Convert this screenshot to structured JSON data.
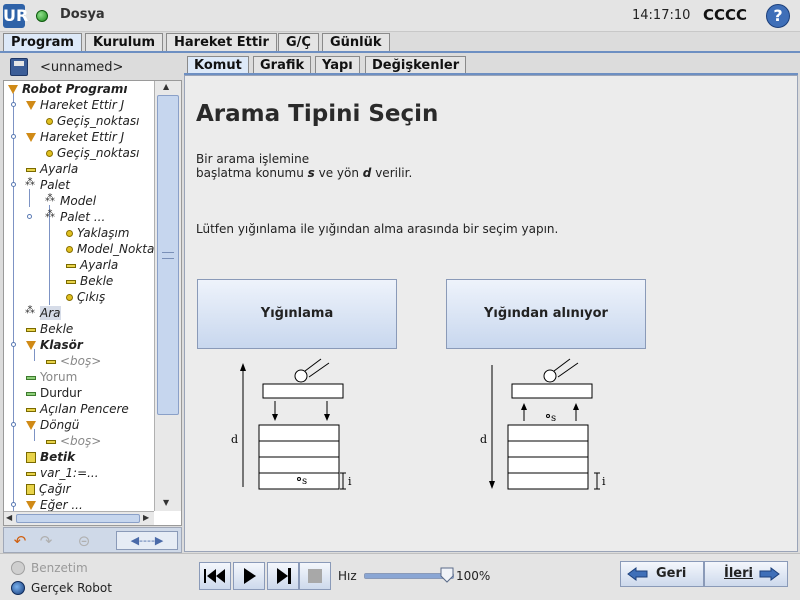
{
  "titlebar": {
    "file_name": "Dosya",
    "clock": "14:17:10",
    "robot_name": "CCCC",
    "logo_text": "UR",
    "help_text": "?"
  },
  "main_tabs": [
    "Program",
    "Kurulum",
    "Hareket Ettir",
    "G/Ç",
    "Günlük"
  ],
  "program": {
    "name": "<unnamed>"
  },
  "tree": {
    "items": [
      {
        "label": "Robot Programı",
        "icon": "program-icon"
      },
      {
        "label": "Hareket Ettir J",
        "icon": "move-icon"
      },
      {
        "label": "Geçiş_noktası",
        "icon": "waypoint-icon"
      },
      {
        "label": "Hareket Ettir J",
        "icon": "move-icon"
      },
      {
        "label": "Geçiş_noktası",
        "icon": "waypoint-icon"
      },
      {
        "label": "Ayarla",
        "icon": "set-icon"
      },
      {
        "label": "Palet",
        "icon": "pallet-icon"
      },
      {
        "label": "Model",
        "icon": "pattern-icon"
      },
      {
        "label": "Palet ...",
        "icon": "pallet-sequence-icon"
      },
      {
        "label": "Yaklaşım",
        "icon": "waypoint-icon"
      },
      {
        "label": "Model_Nokta",
        "icon": "waypoint-icon"
      },
      {
        "label": "Ayarla",
        "icon": "set-icon"
      },
      {
        "label": "Bekle",
        "icon": "wait-icon"
      },
      {
        "label": "Çıkış",
        "icon": "waypoint-icon"
      },
      {
        "label": "Ara",
        "icon": "seek-icon"
      },
      {
        "label": "Bekle",
        "icon": "wait-icon"
      },
      {
        "label": "Klasör",
        "icon": "folder-icon"
      },
      {
        "label": "<boş>",
        "icon": "empty-icon"
      },
      {
        "label": "Yorum",
        "icon": "comment-icon"
      },
      {
        "label": "Durdur",
        "icon": "halt-icon"
      },
      {
        "label": "Açılan Pencere",
        "icon": "popup-icon"
      },
      {
        "label": "Döngü",
        "icon": "loop-icon"
      },
      {
        "label": "<boş>",
        "icon": "empty-icon"
      },
      {
        "label": "Betik",
        "icon": "script-icon"
      },
      {
        "label": "var_1:=...",
        "icon": "assignment-icon"
      },
      {
        "label": "Çağır",
        "icon": "call-icon"
      },
      {
        "label": "Eğer ...",
        "icon": "if-icon"
      }
    ]
  },
  "sub_tabs": [
    "Komut",
    "Grafik",
    "Yapı",
    "Değişkenler"
  ],
  "content": {
    "title": "Arama Tipini Seçin",
    "desc_line1": "Bir arama işlemine",
    "desc_line2_pre": "başlatma konumu ",
    "desc_s": "s",
    "desc_mid": " ve yön ",
    "desc_d": "d",
    "desc_post": " verilir.",
    "prompt": "Lütfen yığınlama ile yığından alma arasında bir seçim yapın.",
    "stack_button": "Yığınlama",
    "destack_button": "Yığından alınıyor",
    "diagram_label_d": "d",
    "diagram_label_s": "s",
    "diagram_label_i": "i"
  },
  "bottom": {
    "sim_label": "Benzetim",
    "real_label": "Gerçek Robot",
    "speed_label": "Hız",
    "speed_value": "100%",
    "speed_level": 1.0,
    "back_button": "Geri",
    "next_button": "İleri",
    "move_button": "◀----▶"
  },
  "colors": {
    "accent": "#6d8fc2",
    "button_top": "#eef3fb",
    "button_bottom": "#c8d7ee",
    "run_status": "#1d8a1d"
  }
}
